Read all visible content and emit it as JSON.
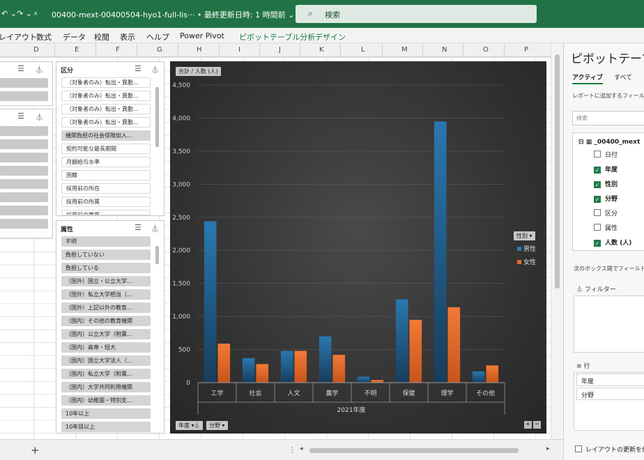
{
  "titlebar": {
    "undo": "↶ ⌄",
    "redo": "↷ ⌄",
    "customize": "⩡",
    "doc_title": "00400-mext-00400504-hyo1-full-lis··· • 最終更新日時: 1 時間前 ⌄",
    "search_placeholder": "検索"
  },
  "ribbon": {
    "tabs": [
      "レイアウト",
      "数式",
      "データ",
      "校閲",
      "表示",
      "ヘルプ",
      "Power Pivot"
    ],
    "context_tabs": [
      "ピボットテーブル分析",
      "デザイン"
    ]
  },
  "columns": [
    "D",
    "E",
    "F",
    "G",
    "H",
    "I",
    "J",
    "K",
    "L",
    "M",
    "N",
    "O",
    "P"
  ],
  "slicers": {
    "left_top": {
      "filter_icons": "☰ ⏃"
    },
    "left_bottom": {
      "filter_icons": "☰ ⏃"
    },
    "kubun": {
      "title": "区分",
      "items": [
        "（対象者のみ）転出・異動…",
        "（対象者のみ）転出・異動…",
        "（対象者のみ）転出・異動…",
        "（対象者のみ）転出・異動…",
        "機関負担の社会保険加入…",
        "契約可能な最長期間",
        "月額給与水準",
        "国籍",
        "採用前の所在",
        "採用前の所属",
        "採用前の職業"
      ]
    },
    "zokusei": {
      "title": "属性",
      "items": [
        "不明",
        "負担していない",
        "負担している",
        "（国外）国立・公立大学…",
        "（国外）私立大学相当（…",
        "（国外）上記以外の教育…",
        "（国内）その他の教育機関",
        "（国内）公立大学（附属…",
        "（国内）高専・短大",
        "（国内）国立大学法人（…",
        "（国内）私立大学（附属…",
        "（国内）大学共同利用機関",
        "（国内）幼稚園・特別支…",
        "10年以上",
        "10年目以上"
      ]
    }
  },
  "chart_data": {
    "type": "bar",
    "title": "合計 / 人数 (人)",
    "categories": [
      "工学",
      "社会",
      "人文",
      "農学",
      "不明",
      "保健",
      "理学",
      "その他"
    ],
    "group_label": "2021年度",
    "series": [
      {
        "name": "男性",
        "color": "#1f5e8a",
        "values": [
          2440,
          370,
          480,
          700,
          90,
          1260,
          3950,
          170
        ]
      },
      {
        "name": "女性",
        "color": "#e8692a",
        "values": [
          590,
          280,
          480,
          420,
          40,
          950,
          1140,
          260
        ]
      }
    ],
    "ylim": [
      0,
      4500
    ],
    "yticks": [
      "0",
      "500",
      "1,000",
      "1,500",
      "2,000",
      "2,500",
      "3,000",
      "3,500",
      "4,000",
      "4,500"
    ],
    "legend_title": "性別",
    "legend_position": "right",
    "axis_buttons": [
      "年度",
      "分野"
    ],
    "zoom": [
      "+",
      "−"
    ]
  },
  "pane": {
    "title": "ピボットテーブル",
    "tabs": [
      "アクティブ",
      "すべて"
    ],
    "instruction": "レポートに追加するフィール",
    "search_placeholder": "検索",
    "table_name": "_00400_mext",
    "fields": [
      {
        "label": "日付",
        "checked": false
      },
      {
        "label": "年度",
        "checked": true
      },
      {
        "label": "性別",
        "checked": true
      },
      {
        "label": "分野",
        "checked": true
      },
      {
        "label": "区分",
        "checked": false
      },
      {
        "label": "属性",
        "checked": false
      },
      {
        "label": "人数 (人)",
        "checked": true
      }
    ],
    "instruction2": "次のボックス間でフィールド",
    "filter_label": "フィルター",
    "rows_label": "行",
    "rows_items": [
      "年度",
      "分野"
    ],
    "defer_label": "レイアウトの更新を保"
  },
  "sheetbar": {
    "add": "+"
  }
}
